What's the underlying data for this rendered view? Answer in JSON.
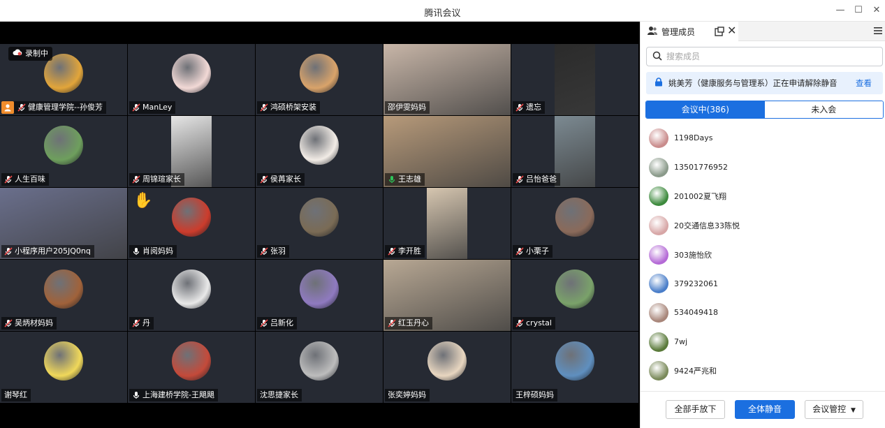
{
  "window": {
    "title": "腾讯会议",
    "minimize": "—",
    "maximize": "☐",
    "close": "✕"
  },
  "recording": {
    "label": "录制中"
  },
  "colors": {
    "accent": "#1b6fe0",
    "active_speaker": "#2ec55a",
    "host_badge": "#f08c2c"
  },
  "tiles": [
    {
      "name": "健康管理学院--孙俊芳",
      "mic": "muted",
      "host": true,
      "avatar": "cartoon-horse",
      "avatar_color": "#e2a53a"
    },
    {
      "name": "ManLey",
      "mic": "muted",
      "avatar": "anime-girl",
      "avatar_color": "#f2d9d6"
    },
    {
      "name": "鸿硕桥架安装",
      "mic": "muted",
      "avatar": "sunset-person",
      "avatar_color": "#d9a36a"
    },
    {
      "name": "邵伊雯妈妈",
      "mic": "none",
      "photo": true,
      "avatar_color": "#c8b6a8"
    },
    {
      "name": "遗忘",
      "mic": "muted",
      "photo": true,
      "avatar_color": "#2b2b2b"
    },
    {
      "name": "人生百味",
      "mic": "muted",
      "avatar": "red-dancer",
      "avatar_color": "#6e9f5d"
    },
    {
      "name": "周锦瑄家长",
      "mic": "muted",
      "photo": true,
      "avatar_color": "#e6e6e6"
    },
    {
      "name": "侯苒家长",
      "mic": "muted",
      "avatar": "seal-logo",
      "avatar_color": "#f2ece6"
    },
    {
      "name": "王志雄",
      "mic": "active",
      "photo": true,
      "active": true,
      "avatar_color": "#b79a7a"
    },
    {
      "name": "吕怡爸爸",
      "mic": "muted",
      "photo": true,
      "avatar_color": "#7c8a92"
    },
    {
      "name": "小程序用户205JQ0nq",
      "mic": "muted",
      "photo": true,
      "avatar_color": "#6a6f8c"
    },
    {
      "name": "肖阅妈妈",
      "mic": "on",
      "avatar": "red-figure",
      "avatar_color": "#cc3c2c",
      "hand": true
    },
    {
      "name": "张羽",
      "mic": "muted",
      "avatar": "bridge-person",
      "avatar_color": "#7a6b55"
    },
    {
      "name": "李开胜",
      "mic": "muted",
      "photo": true,
      "avatar_color": "#d6c6b0"
    },
    {
      "name": "小栗子",
      "mic": "muted",
      "avatar": "couple",
      "avatar_color": "#8a6a5a"
    },
    {
      "name": "吴炳材妈妈",
      "mic": "muted",
      "avatar": "pastry",
      "avatar_color": "#a0623a"
    },
    {
      "name": "丹",
      "mic": "muted",
      "avatar": "young-man",
      "avatar_color": "#e9e9e9"
    },
    {
      "name": "吕新化",
      "mic": "muted",
      "avatar": "lavender-field",
      "avatar_color": "#8f7ac0"
    },
    {
      "name": "红玉丹心",
      "mic": "muted",
      "photo": true,
      "avatar_color": "#b8a894"
    },
    {
      "name": "crystal",
      "mic": "muted",
      "avatar": "white-building",
      "avatar_color": "#7aa26a"
    },
    {
      "name": "谢琴红",
      "mic": "none",
      "avatar": "lemon-slices",
      "avatar_color": "#f0d85a"
    },
    {
      "name": "上海建桥学院-王飓飓",
      "mic": "on",
      "avatar": "child-red",
      "avatar_color": "#c44a3a"
    },
    {
      "name": "沈思捷家长",
      "mic": "none",
      "avatar": "bw-portrait",
      "avatar_color": "#bdbdbd"
    },
    {
      "name": "张奕婷妈妈",
      "mic": "none",
      "avatar": "chibi",
      "avatar_color": "#e8d6c0"
    },
    {
      "name": "王梓硕妈妈",
      "mic": "none",
      "avatar": "beach-girl",
      "avatar_color": "#5f8fbf"
    }
  ],
  "panel": {
    "tab_label": "管理成员",
    "search_placeholder": "搜索成员",
    "notice_text": "姚美芳（健康服务与管理系）正在申请解除静音",
    "notice_action": "查看",
    "seg_in": "会议中(386)",
    "seg_out": "未入会",
    "members": [
      {
        "name": "1198Days",
        "color": "#c98c8c"
      },
      {
        "name": "13501776952",
        "color": "#8a9a8a"
      },
      {
        "name": "201002夏飞翔",
        "color": "#3d8a3d"
      },
      {
        "name": "20交通信息33陈悦",
        "color": "#d7a6a6"
      },
      {
        "name": "303施怡欣",
        "color": "#b46ad6"
      },
      {
        "name": "379232061",
        "color": "#4a7ec9"
      },
      {
        "name": "534049418",
        "color": "#a8867a"
      },
      {
        "name": "7wj",
        "color": "#5a7a3a"
      },
      {
        "name": "9424严兆和",
        "color": "#7a8a5a"
      }
    ],
    "footer": {
      "raise_all": "全部手放下",
      "mute_all": "全体静音",
      "manage": "会议管控"
    }
  }
}
